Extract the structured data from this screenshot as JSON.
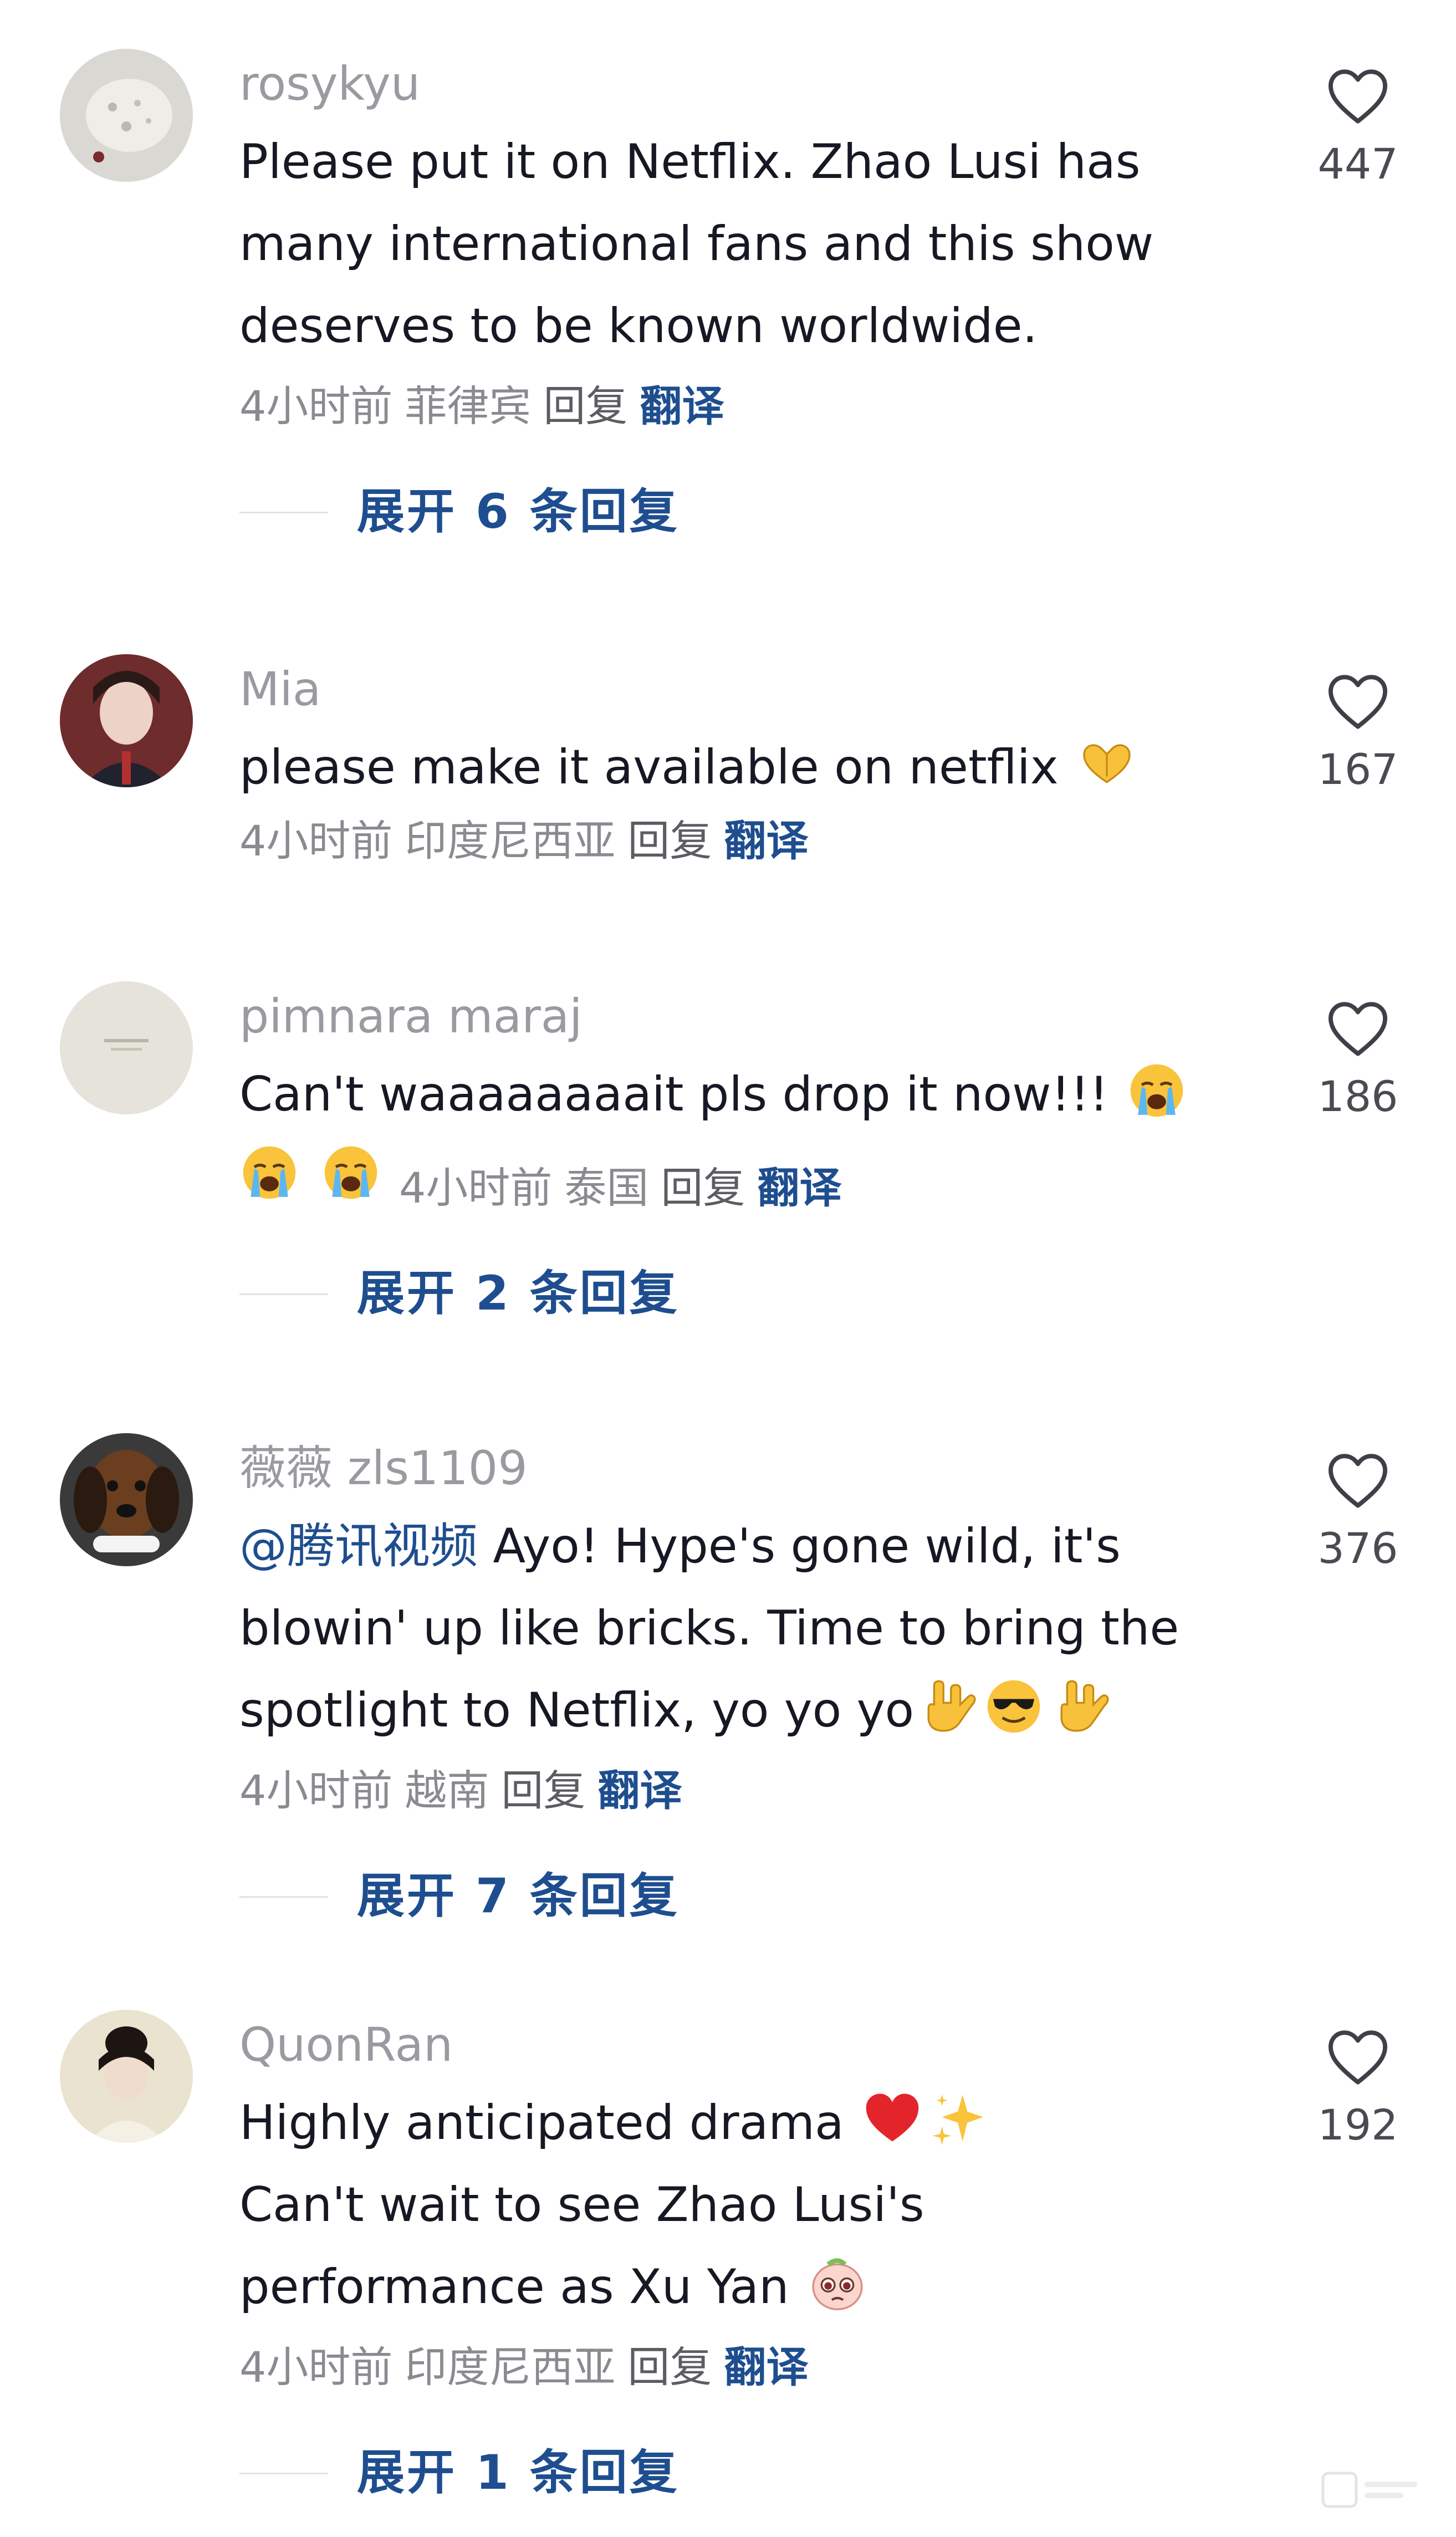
{
  "comments": [
    {
      "username": "rosykyu",
      "text": "Please put it on Netflix. Zhao Lusi has many international fans and this show deserves to be known worldwide.",
      "time": "4小时前",
      "location": "菲律宾",
      "reply_label": "回复",
      "translate_label": "翻译",
      "likes": "447",
      "expand_label": "展开 6 条回复"
    },
    {
      "username": "Mia",
      "text": "please make it available on netflix",
      "time": "4小时前",
      "location": "印度尼西亚",
      "reply_label": "回复",
      "translate_label": "翻译",
      "likes": "167"
    },
    {
      "username": "pimnara maraj",
      "text": "Can't waaaaaaaait pls drop it now!!!",
      "time": "4小时前",
      "location": "泰国",
      "reply_label": "回复",
      "translate_label": "翻译",
      "likes": "186",
      "expand_label": "展开 2 条回复"
    },
    {
      "username": "薇薇 zls1109",
      "mention": "@腾讯视频",
      "text": " Ayo! Hype's gone wild, it's blowin' up like bricks. Time to bring the spotlight to Netflix, yo yo yo",
      "time": "4小时前",
      "location": "越南",
      "reply_label": "回复",
      "translate_label": "翻译",
      "likes": "376",
      "expand_label": "展开 7 条回复"
    },
    {
      "username": "QuonRan",
      "text_line1": "Highly anticipated drama",
      "text_line2": "Can't wait to see Zhao Lusi's",
      "text_line3": "performance as Xu Yan",
      "time": "4小时前",
      "location": "印度尼西亚",
      "reply_label": "回复",
      "translate_label": "翻译",
      "likes": "192",
      "expand_label": "展开 1 条回复"
    }
  ],
  "icons": {
    "like": "heart-outline-icon",
    "emoji_heart_hands": "heart-hands-emoji",
    "emoji_crying": "loudly-crying-face-emoji",
    "emoji_rock": "love-you-gesture-emoji",
    "emoji_sunglasses": "smiling-face-with-sunglasses-emoji",
    "emoji_red_heart": "red-heart-emoji",
    "emoji_sparkles": "sparkles-emoji",
    "emoji_pleading": "pleading-face-emoji"
  },
  "colors": {
    "username": "#9a9aa1",
    "text": "#161823",
    "link": "#1e4e8f",
    "meta": "#8a8b91"
  }
}
